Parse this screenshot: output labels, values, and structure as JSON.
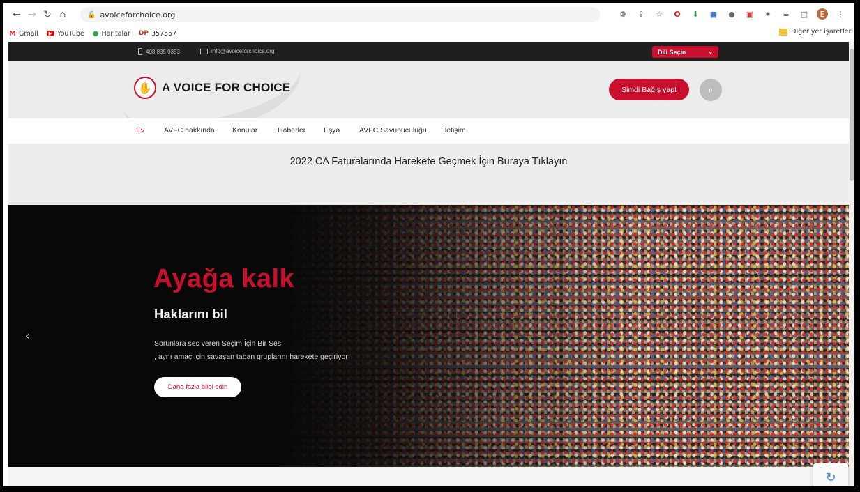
{
  "browser": {
    "url": "avoiceforchoice.org",
    "bookmarks": [
      {
        "label": "Gmail",
        "icon": "gmail-icon"
      },
      {
        "label": "YouTube",
        "icon": "youtube-icon"
      },
      {
        "label": "Haritalar",
        "icon": "maps-icon"
      },
      {
        "label": "357557",
        "icon": "dp-icon",
        "prefix": "DP"
      }
    ],
    "other_bookmarks": "Diğer yer işaretleri",
    "profile_initial": "E"
  },
  "topbar": {
    "phone": "408 835 9353",
    "email": "info@avoiceforchoice.org",
    "language_select": "Dili Seçin"
  },
  "header": {
    "logo_text": "A VOICE FOR CHOICE",
    "donate_label": "Şimdi Bağış yap!"
  },
  "nav": {
    "items": [
      "Ev",
      "AVFC hakkında",
      "Konular",
      "Haberler",
      "Eşya",
      "AVFC Savunuculuğu",
      "İletişim"
    ]
  },
  "banner": {
    "text": "2022 CA Faturalarında Harekete Geçmek İçin Buraya Tıklayın"
  },
  "hero": {
    "title": "Ayağa kalk",
    "subtitle": "Haklarını bil",
    "description_line1": "Sorunlara ses veren Seçim İçin Bir Ses",
    "description_line2": ", aynı amaç için savaşan taban gruplarını harekete geçiriyor",
    "cta_label": "Daha fazla bilgi edin"
  },
  "colors": {
    "accent": "#c8102e",
    "topbar_bg": "#1f1f1f",
    "header_bg": "#ececec"
  }
}
